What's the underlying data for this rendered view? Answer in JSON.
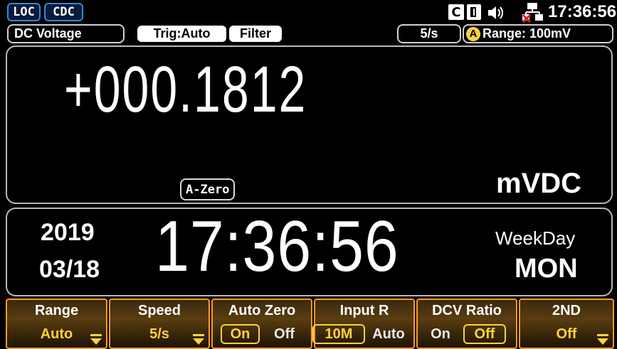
{
  "status_bar": {
    "loc": "LOC",
    "cdc": "CDC",
    "c_badge": "C",
    "time": "17:36:56"
  },
  "info_bar": {
    "function": "DC Voltage",
    "trigger": "Trig:Auto",
    "filter": "Filter",
    "rate": "5/s",
    "auto_badge": "A",
    "range": "Range: 100mV"
  },
  "measurement": {
    "reading": "+000.1812",
    "unit": "mVDC",
    "a_zero": "A-Zero"
  },
  "datetime": {
    "year": "2019",
    "month_day": "03/18",
    "time": "17:36:56",
    "weekday_label": "WeekDay",
    "weekday": "MON"
  },
  "softkeys": [
    {
      "title": "Range",
      "value": "Auto"
    },
    {
      "title": "Speed",
      "value": "5/s"
    },
    {
      "title": "Auto Zero",
      "options": [
        "On",
        "Off"
      ],
      "selected": "On"
    },
    {
      "title": "Input R",
      "options": [
        "10M",
        "Auto"
      ],
      "selected": "10M"
    },
    {
      "title": "DCV Ratio",
      "options": [
        "On",
        "Off"
      ],
      "selected": "Off"
    },
    {
      "title": "2ND",
      "value": "Off"
    }
  ],
  "colors": {
    "accent_orange": "#ff9a2a",
    "value_yellow": "#ffd23c",
    "tag_blue": "#2e8bd8",
    "network_x": "#e02020"
  }
}
